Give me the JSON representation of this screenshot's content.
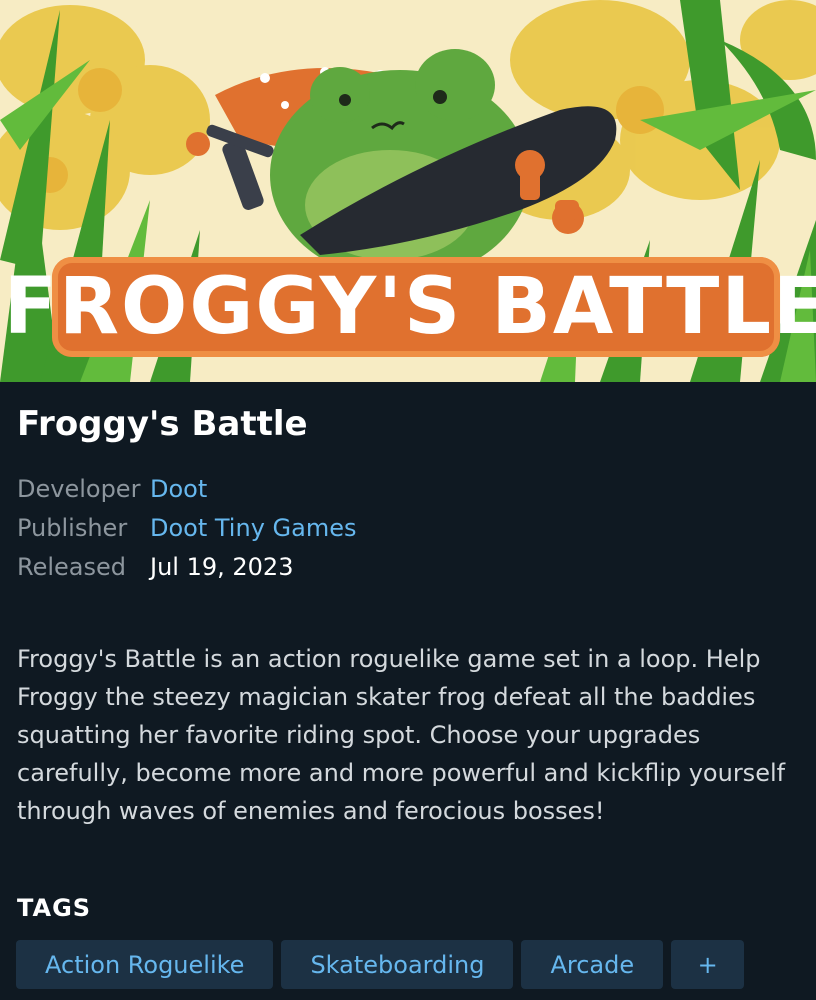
{
  "header_image": {
    "logo_text": "FROGGY'S BATTLE",
    "colors": {
      "background": "#f7ecc4",
      "frog": "#5fa83f",
      "logo_fill": "#e0712f",
      "leaves": "#3f9a2c"
    }
  },
  "game": {
    "title": "Froggy's Battle",
    "developer_label": "Developer",
    "developer": "Doot",
    "publisher_label": "Publisher",
    "publisher": "Doot Tiny Games",
    "released_label": "Released",
    "released": "Jul 19, 2023",
    "description": "Froggy's Battle is an action roguelike game set in a loop. Help Froggy the steezy magician skater frog defeat all the baddies squatting her favorite riding spot. Choose your upgrades carefully, become more and more powerful and kickflip yourself through waves of enemies and ferocious bosses!"
  },
  "tags": {
    "heading": "TAGS",
    "items": [
      "Action Roguelike",
      "Skateboarding",
      "Arcade"
    ],
    "more_label": "+"
  },
  "colors": {
    "background": "#0f1922",
    "link": "#66b7ee",
    "tag_background": "#1c3144",
    "muted": "#8d969e"
  }
}
